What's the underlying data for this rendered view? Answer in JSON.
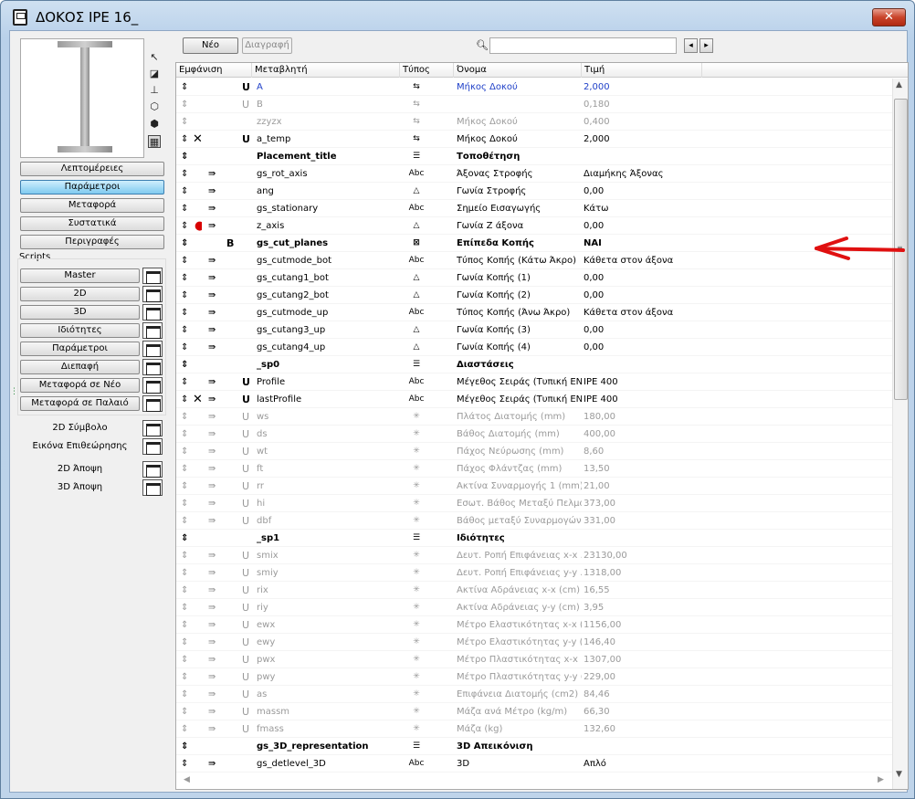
{
  "window": {
    "title": "ΔΟΚΟΣ IPE 16_",
    "close_label": "✕"
  },
  "left": {
    "tabs": [
      {
        "label": "Λεπτομέρειες",
        "active": false
      },
      {
        "label": "Παράμετροι",
        "active": true
      },
      {
        "label": "Μεταφορά",
        "active": false
      },
      {
        "label": "Συστατικά",
        "active": false
      },
      {
        "label": "Περιγραφές",
        "active": false
      }
    ],
    "scripts_label": "Scripts",
    "scripts": [
      "Master",
      "2D",
      "3D",
      "Ιδιότητες",
      "Παράμετροι",
      "Διεπαφή",
      "Μεταφορά σε Νέο",
      "Μεταφορά σε Παλαιό"
    ],
    "views": [
      "2D Σύμβολο",
      "Εικόνα Επιθεώρησης"
    ],
    "views2": [
      "2D Άποψη",
      "3D Άποψη"
    ]
  },
  "toolbar": {
    "new_label": "Νέο",
    "delete_label": "Διαγραφή",
    "search_value": "",
    "prev": "◂",
    "next": "▸"
  },
  "columns": {
    "show": "Εμφάνιση",
    "variable": "Μεταβλητή",
    "type": "Τύπος",
    "name": "Όνομα",
    "value": "Τιμή"
  },
  "rows": [
    {
      "move": "⇕",
      "x": "",
      "dot": "",
      "child": "",
      "b": "",
      "u": "U",
      "var": "A",
      "type": "⇆",
      "name": "Μήκος Δοκού",
      "val": "2,000",
      "style": "link"
    },
    {
      "move": "⇕",
      "x": "",
      "dot": "",
      "child": "",
      "b": "",
      "u": "U",
      "var": "B",
      "type": "⇆",
      "name": "",
      "val": "0,180",
      "style": "dis"
    },
    {
      "move": "⇕",
      "x": "",
      "dot": "",
      "child": "",
      "b": "",
      "u": "",
      "var": "zzyzx",
      "type": "⇆",
      "name": "Μήκος Δοκού",
      "val": "0,400",
      "style": "dis"
    },
    {
      "move": "⇕",
      "x": "✕",
      "dot": "",
      "child": "",
      "b": "",
      "u": "U",
      "var": "a_temp",
      "type": "⇆",
      "name": "Μήκος Δοκού",
      "val": "2,000",
      "style": ""
    },
    {
      "move": "⇕",
      "x": "",
      "dot": "",
      "child": "",
      "b": "",
      "u": "",
      "var": "Placement_title",
      "type": "☰",
      "name": "Τοποθέτηση",
      "val": "",
      "style": "title"
    },
    {
      "move": "⇕",
      "x": "",
      "dot": "",
      "child": "⇛",
      "b": "",
      "u": "",
      "var": "gs_rot_axis",
      "type": "Abc",
      "name": "Άξονας Στροφής",
      "val": "Διαμήκης Άξονας",
      "style": ""
    },
    {
      "move": "⇕",
      "x": "",
      "dot": "",
      "child": "⇛",
      "b": "",
      "u": "",
      "var": "ang",
      "type": "△",
      "name": "Γωνία Στροφής",
      "val": "0,00",
      "style": ""
    },
    {
      "move": "⇕",
      "x": "",
      "dot": "",
      "child": "⇛",
      "b": "",
      "u": "",
      "var": "gs_stationary",
      "type": "Abc",
      "name": "Σημείο Εισαγωγής",
      "val": "Κάτω",
      "style": ""
    },
    {
      "move": "⇕",
      "x": "",
      "dot": "●",
      "child": "⇛",
      "b": "",
      "u": "",
      "var": "z_axis",
      "type": "△",
      "name": "Γωνία Ζ άξονα",
      "val": "0,00",
      "style": ""
    },
    {
      "move": "⇕",
      "x": "",
      "dot": "",
      "child": "",
      "b": "B",
      "u": "",
      "var": "gs_cut_planes",
      "type": "⊠",
      "name": "Επίπεδα Κοπής",
      "val": "ΝΑΙ",
      "style": "title"
    },
    {
      "move": "⇕",
      "x": "",
      "dot": "",
      "child": "⇛",
      "b": "",
      "u": "",
      "var": "gs_cutmode_bot",
      "type": "Abc",
      "name": "Τύπος Κοπής (Κάτω Άκρο)",
      "val": "Κάθετα στον άξονα",
      "style": ""
    },
    {
      "move": "⇕",
      "x": "",
      "dot": "",
      "child": "⇛",
      "b": "",
      "u": "",
      "var": "gs_cutang1_bot",
      "type": "△",
      "name": "Γωνία Κοπής (1)",
      "val": "0,00",
      "style": ""
    },
    {
      "move": "⇕",
      "x": "",
      "dot": "",
      "child": "⇛",
      "b": "",
      "u": "",
      "var": "gs_cutang2_bot",
      "type": "△",
      "name": "Γωνία Κοπής (2)",
      "val": "0,00",
      "style": ""
    },
    {
      "move": "⇕",
      "x": "",
      "dot": "",
      "child": "⇛",
      "b": "",
      "u": "",
      "var": "gs_cutmode_up",
      "type": "Abc",
      "name": "Τύπος Κοπής (Άνω Άκρο)",
      "val": "Κάθετα στον άξονα",
      "style": ""
    },
    {
      "move": "⇕",
      "x": "",
      "dot": "",
      "child": "⇛",
      "b": "",
      "u": "",
      "var": "gs_cutang3_up",
      "type": "△",
      "name": "Γωνία Κοπής (3)",
      "val": "0,00",
      "style": ""
    },
    {
      "move": "⇕",
      "x": "",
      "dot": "",
      "child": "⇛",
      "b": "",
      "u": "",
      "var": "gs_cutang4_up",
      "type": "△",
      "name": "Γωνία Κοπής (4)",
      "val": "0,00",
      "style": ""
    },
    {
      "move": "⇕",
      "x": "",
      "dot": "",
      "child": "",
      "b": "",
      "u": "",
      "var": "_sp0",
      "type": "☰",
      "name": "Διαστάσεις",
      "val": "",
      "style": "title"
    },
    {
      "move": "⇕",
      "x": "",
      "dot": "",
      "child": "⇛",
      "b": "",
      "u": "U",
      "var": "Profile",
      "type": "Abc",
      "name": "Μέγεθος Σειράς (Τυπική EN)",
      "val": "IPE 400",
      "style": ""
    },
    {
      "move": "⇕",
      "x": "✕",
      "dot": "",
      "child": "⇛",
      "b": "",
      "u": "U",
      "var": "lastProfile",
      "type": "Abc",
      "name": "Μέγεθος Σειράς (Τυπική EN)",
      "val": "IPE 400",
      "style": ""
    },
    {
      "move": "⇕",
      "x": "",
      "dot": "",
      "child": "⇛",
      "b": "",
      "u": "U",
      "var": "ws",
      "type": "✳",
      "name": "Πλάτος Διατομής (mm)",
      "val": "180,00",
      "style": "dis"
    },
    {
      "move": "⇕",
      "x": "",
      "dot": "",
      "child": "⇛",
      "b": "",
      "u": "U",
      "var": "ds",
      "type": "✳",
      "name": "Βάθος Διατομής (mm)",
      "val": "400,00",
      "style": "dis"
    },
    {
      "move": "⇕",
      "x": "",
      "dot": "",
      "child": "⇛",
      "b": "",
      "u": "U",
      "var": "wt",
      "type": "✳",
      "name": "Πάχος Νεύρωσης (mm)",
      "val": "8,60",
      "style": "dis"
    },
    {
      "move": "⇕",
      "x": "",
      "dot": "",
      "child": "⇛",
      "b": "",
      "u": "U",
      "var": "ft",
      "type": "✳",
      "name": "Πάχος Φλάντζας (mm)",
      "val": "13,50",
      "style": "dis"
    },
    {
      "move": "⇕",
      "x": "",
      "dot": "",
      "child": "⇛",
      "b": "",
      "u": "U",
      "var": "rr",
      "type": "✳",
      "name": "Ακτίνα Συναρμογής 1 (mm)",
      "val": "21,00",
      "style": "dis"
    },
    {
      "move": "⇕",
      "x": "",
      "dot": "",
      "child": "⇛",
      "b": "",
      "u": "U",
      "var": "hi",
      "type": "✳",
      "name": "Εσωτ. Βάθος Μεταξύ Πελμά...",
      "val": "373,00",
      "style": "dis"
    },
    {
      "move": "⇕",
      "x": "",
      "dot": "",
      "child": "⇛",
      "b": "",
      "u": "U",
      "var": "dbf",
      "type": "✳",
      "name": "Βάθος μεταξύ Συναρμογών ...",
      "val": "331,00",
      "style": "dis"
    },
    {
      "move": "⇕",
      "x": "",
      "dot": "",
      "child": "",
      "b": "",
      "u": "",
      "var": "_sp1",
      "type": "☰",
      "name": "Ιδιότητες",
      "val": "",
      "style": "title"
    },
    {
      "move": "⇕",
      "x": "",
      "dot": "",
      "child": "⇛",
      "b": "",
      "u": "U",
      "var": "smix",
      "type": "✳",
      "name": "Δευτ. Ροπή Επιφάνειας x-x ...",
      "val": "23130,00",
      "style": "dis"
    },
    {
      "move": "⇕",
      "x": "",
      "dot": "",
      "child": "⇛",
      "b": "",
      "u": "U",
      "var": "smiy",
      "type": "✳",
      "name": "Δευτ. Ροπή Επιφάνειας y-y ...",
      "val": "1318,00",
      "style": "dis"
    },
    {
      "move": "⇕",
      "x": "",
      "dot": "",
      "child": "⇛",
      "b": "",
      "u": "U",
      "var": "rix",
      "type": "✳",
      "name": "Ακτίνα Αδράνειας x-x (cm)",
      "val": "16,55",
      "style": "dis"
    },
    {
      "move": "⇕",
      "x": "",
      "dot": "",
      "child": "⇛",
      "b": "",
      "u": "U",
      "var": "riy",
      "type": "✳",
      "name": "Ακτίνα Αδράνειας y-y (cm)",
      "val": "3,95",
      "style": "dis"
    },
    {
      "move": "⇕",
      "x": "",
      "dot": "",
      "child": "⇛",
      "b": "",
      "u": "U",
      "var": "ewx",
      "type": "✳",
      "name": "Μέτρο Ελαστικότητας x-x (c...",
      "val": "1156,00",
      "style": "dis"
    },
    {
      "move": "⇕",
      "x": "",
      "dot": "",
      "child": "⇛",
      "b": "",
      "u": "U",
      "var": "ewy",
      "type": "✳",
      "name": "Μέτρο Ελαστικότητας y-y (c...",
      "val": "146,40",
      "style": "dis"
    },
    {
      "move": "⇕",
      "x": "",
      "dot": "",
      "child": "⇛",
      "b": "",
      "u": "U",
      "var": "pwx",
      "type": "✳",
      "name": "Μέτρο Πλαστικότητας x-x (c...",
      "val": "1307,00",
      "style": "dis"
    },
    {
      "move": "⇕",
      "x": "",
      "dot": "",
      "child": "⇛",
      "b": "",
      "u": "U",
      "var": "pwy",
      "type": "✳",
      "name": "Μέτρο Πλαστικότητας y-y (c...",
      "val": "229,00",
      "style": "dis"
    },
    {
      "move": "⇕",
      "x": "",
      "dot": "",
      "child": "⇛",
      "b": "",
      "u": "U",
      "var": "as",
      "type": "✳",
      "name": "Επιφάνεια Διατομής (cm2)",
      "val": "84,46",
      "style": "dis"
    },
    {
      "move": "⇕",
      "x": "",
      "dot": "",
      "child": "⇛",
      "b": "",
      "u": "U",
      "var": "massm",
      "type": "✳",
      "name": "Μάζα ανά Μέτρο (kg/m)",
      "val": "66,30",
      "style": "dis"
    },
    {
      "move": "⇕",
      "x": "",
      "dot": "",
      "child": "⇛",
      "b": "",
      "u": "U",
      "var": "fmass",
      "type": "✳",
      "name": "Μάζα (kg)",
      "val": "132,60",
      "style": "dis"
    },
    {
      "move": "⇕",
      "x": "",
      "dot": "",
      "child": "",
      "b": "",
      "u": "",
      "var": "gs_3D_representation",
      "type": "☰",
      "name": "3D Απεικόνιση",
      "val": "",
      "style": "title"
    },
    {
      "move": "⇕",
      "x": "",
      "dot": "",
      "child": "⇛",
      "b": "",
      "u": "",
      "var": "gs_detlevel_3D",
      "type": "Abc",
      "name": "3D",
      "val": "Απλό",
      "style": ""
    }
  ]
}
